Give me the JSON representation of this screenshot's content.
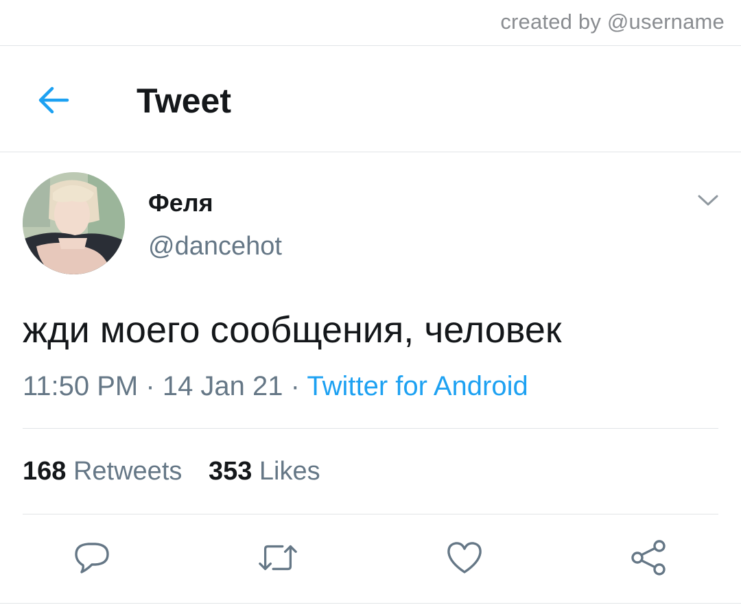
{
  "credit": "created by @username",
  "header": {
    "title": "Tweet",
    "back_icon": "arrow-left-icon",
    "accent_color": "#1da1f2"
  },
  "tweet": {
    "author": {
      "display_name": "Феля",
      "handle": "@dancehot"
    },
    "text": "жди моего сообщения, человек",
    "time": "11:50 PM",
    "separator": "·",
    "date": "14 Jan 21",
    "source": "Twitter for Android",
    "stats": {
      "retweets_count": "168",
      "retweets_label": "Retweets",
      "likes_count": "353",
      "likes_label": "Likes"
    },
    "actions": [
      {
        "name": "reply",
        "icon": "reply-icon"
      },
      {
        "name": "retweet",
        "icon": "retweet-icon"
      },
      {
        "name": "like",
        "icon": "heart-icon"
      },
      {
        "name": "share",
        "icon": "share-icon"
      }
    ]
  },
  "colors": {
    "text_primary": "#14171a",
    "text_secondary": "#657786",
    "link": "#1da1f2",
    "divider": "#e1e4e7"
  }
}
